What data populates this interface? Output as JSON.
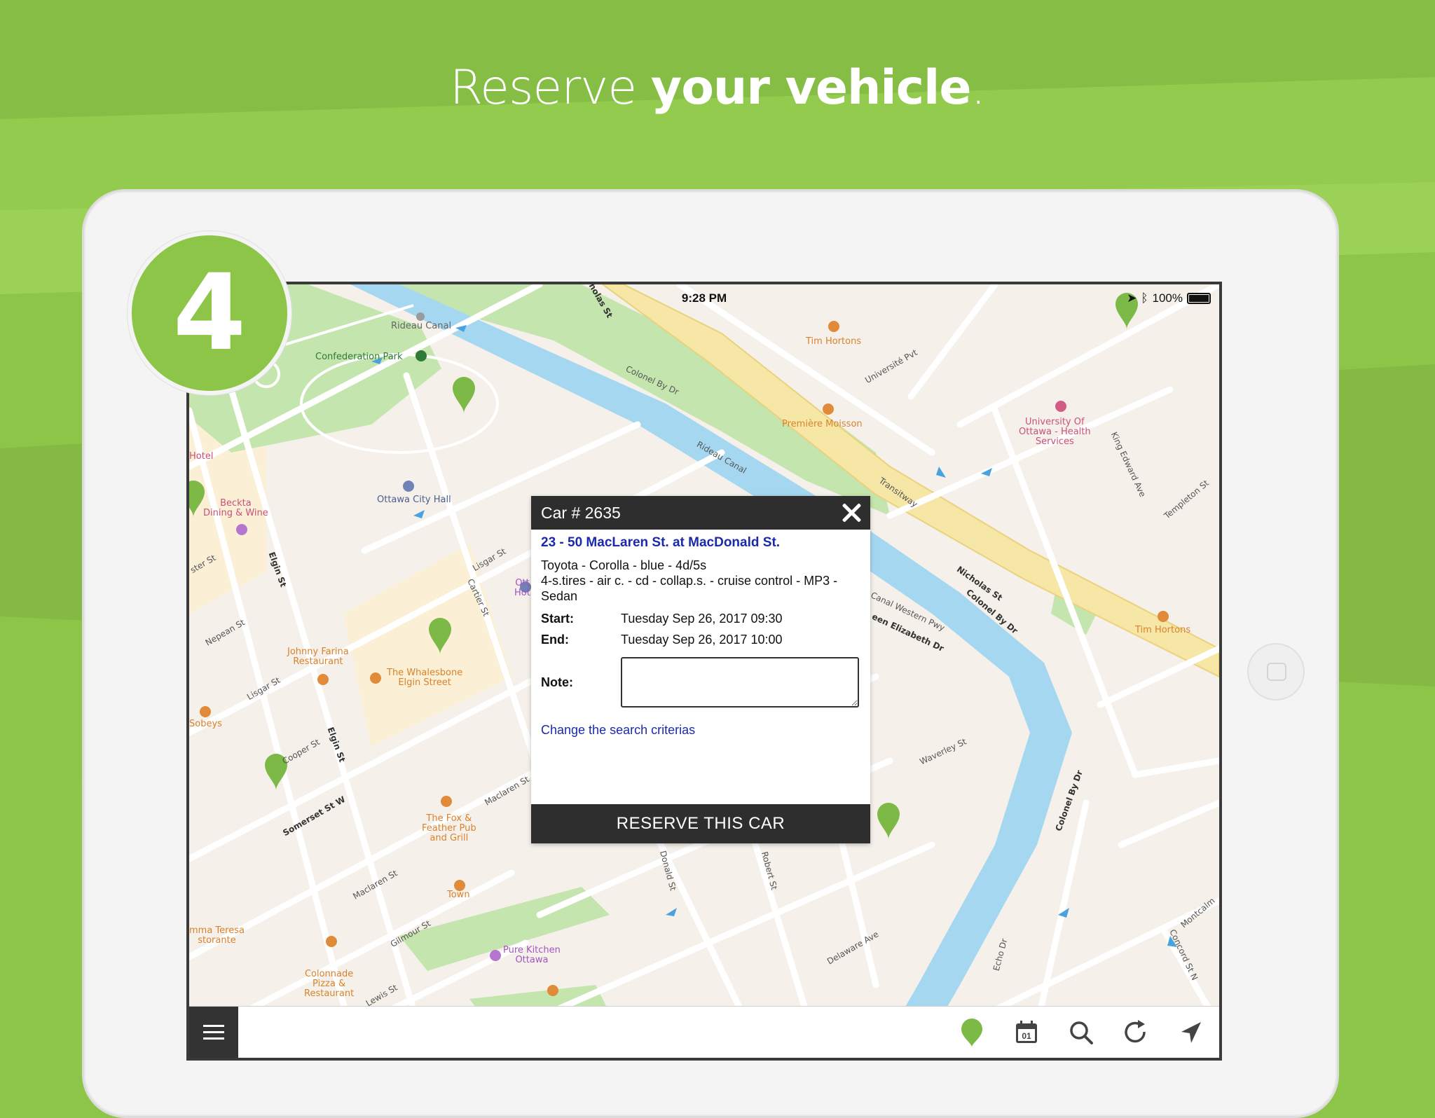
{
  "headline": {
    "light": "Reserve",
    "bold": "your vehicle",
    "end": "."
  },
  "step_number": "4",
  "status_bar": {
    "time": "9:28 PM",
    "battery": "100%"
  },
  "map_labels": {
    "rideau_canal_top": "Rideau Canal",
    "confederation_park": "Confederation Park",
    "tim_hortons_1": "Tim Hortons",
    "universite_pvt": "Université Pvt",
    "colonel_by_dr_1": "Colonel By Dr",
    "premiere_moisson": "Première Moisson",
    "uottawa_health": "University Of\nOttawa - Health\nServices",
    "king_edward": "King Edward Ave",
    "templeton": "Templeton St",
    "hotel": "Hotel",
    "beckta": "Beckta\nDining & Wine",
    "ottawa_city_hall": "Ottawa City Hall",
    "rideau_canal_mid": "Rideau Canal",
    "transitway": "Transitway",
    "nicholas_st": "Nicholas St",
    "colonel_by_dr_2": "Colonel By Dr",
    "elgin_st_1": "Elgin St",
    "lisgar_st_1": "Lisgar St",
    "cartier_st": "Cartier St",
    "ott_hot": "Ott\nHot",
    "canal_western": "Canal Western Pwy",
    "queen_elizabeth": "een Elizabeth Dr",
    "tim_hortons_2": "Tim Hortons",
    "nepean_st": "Nepean St",
    "johnny_farina": "Johnny Farina\nRestaurant",
    "whalesbone": "The Whalesbone\nElgin Street",
    "lisgar_st_2": "Lisgar St",
    "sobeys": "Sobeys",
    "elgin_st_2": "Elgin St",
    "cooper_st": "Cooper St",
    "waverley_st": "Waverley St",
    "somerset": "Somerset St W",
    "maclaren_1": "Maclaren St",
    "fox_feather": "The Fox &\nFeather Pub\nand Grill",
    "colonel_by_dr_3": "Colonel By Dr",
    "donald_st": "Donald St",
    "robert_st": "Robert St",
    "maclaren_2": "Maclaren St",
    "town": "Town",
    "gilmour": "Gilmour St",
    "mma_teresa": "mma Teresa\nstorante",
    "pure_kitchen": "Pure Kitchen\nOttawa",
    "delaware": "Delaware Ave",
    "echo_dr": "Echo Dr",
    "colonnade": "Colonnade\nPizza &\nRestaurant",
    "lewis_st": "Lewis St",
    "concord": "Concord St N",
    "montcalm": "Montcalm",
    "ster_st": "ster St",
    "nicholas_st_top": "holas St"
  },
  "dialog": {
    "title": "Car # 2635",
    "address": "23 - 50 MacLaren St. at MacDonald St.",
    "vehicle": "Toyota - Corolla - blue - 4d/5s",
    "features": "4-s.tires - air c. - cd - collap.s. - cruise control - MP3 - Sedan",
    "start_label": "Start:",
    "start_value": "Tuesday Sep 26, 2017 09:30",
    "end_label": "End:",
    "end_value": "Tuesday Sep 26, 2017 10:00",
    "note_label": "Note:",
    "note_value": "",
    "change_link": "Change the search criterias",
    "reserve_button": "RESERVE THIS CAR"
  },
  "toolbar": {
    "calendar_day": "01",
    "icons": [
      "menu-icon",
      "location-pin-icon",
      "calendar-icon",
      "search-icon",
      "refresh-icon",
      "navigation-arrow-icon"
    ]
  },
  "colors": {
    "brand_green": "#8cc548",
    "pin_green": "#7cb946",
    "dialog_dark": "#2e2e2e",
    "link_blue": "#1b2aa8",
    "water": "#a5d8f0",
    "park": "#c4e5ae"
  }
}
